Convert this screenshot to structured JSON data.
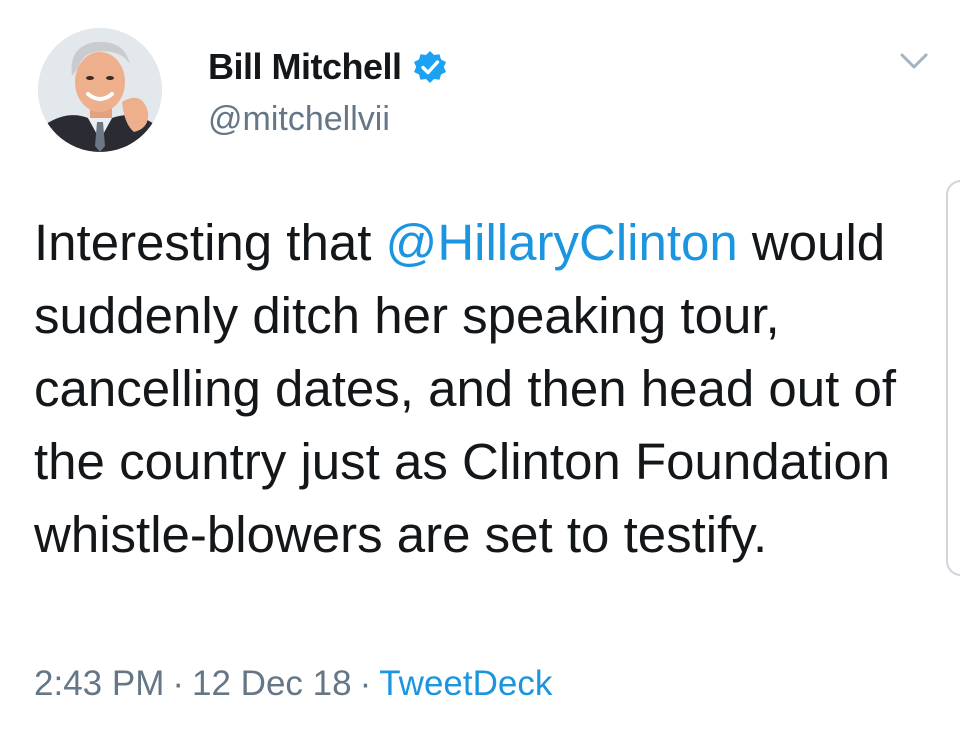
{
  "user": {
    "display_name": "Bill Mitchell",
    "handle": "@mitchellvii",
    "verified": true,
    "avatar_icon": "profile-photo"
  },
  "tweet": {
    "text_before": "Interesting that ",
    "mention": "@HillaryClinton",
    "text_after": " would suddenly ditch her speaking tour, cancelling dates, and then head out of the country just as Clinton Foundation whistle-blowers are set to testify.",
    "time": "2:43 PM",
    "date": "12 Dec 18",
    "separator": "·",
    "source": "TweetDeck"
  },
  "icons": {
    "verified": "verified-badge-icon",
    "menu": "chevron-down-icon"
  },
  "colors": {
    "link": "#1b95e0",
    "verified": "#1da1f2",
    "text": "#14171a",
    "secondary": "#657786"
  }
}
